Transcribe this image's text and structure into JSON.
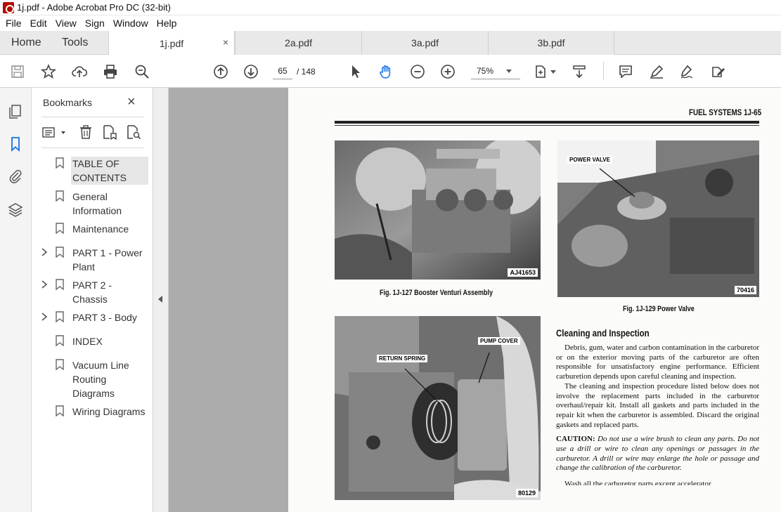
{
  "window": {
    "title": "1j.pdf - Adobe Acrobat Pro DC (32-bit)"
  },
  "menu": [
    "File",
    "Edit",
    "View",
    "Sign",
    "Window",
    "Help"
  ],
  "nav_tabs": {
    "home": "Home",
    "tools": "Tools"
  },
  "doc_tabs": [
    {
      "label": "1j.pdf",
      "active": true,
      "close": "×"
    },
    {
      "label": "2a.pdf"
    },
    {
      "label": "3a.pdf"
    },
    {
      "label": "3b.pdf"
    }
  ],
  "toolbar": {
    "page_current": "65",
    "page_total": "/ 148",
    "zoom": "75%"
  },
  "bookmarks": {
    "title": "Bookmarks",
    "close": "×",
    "items": [
      {
        "label": "TABLE OF CONTENTS",
        "expandable": false,
        "selected": true
      },
      {
        "label": "General Information",
        "expandable": false
      },
      {
        "label": "Maintenance",
        "expandable": false
      },
      {
        "label": "PART 1 - Power Plant",
        "expandable": true
      },
      {
        "label": "PART 2 - Chassis",
        "expandable": true
      },
      {
        "label": "PART 3 - Body",
        "expandable": true
      },
      {
        "label": "INDEX",
        "expandable": false
      },
      {
        "label": "Vacuum Line Routing Diagrams",
        "expandable": false
      },
      {
        "label": "Wiring Diagrams",
        "expandable": false
      }
    ]
  },
  "document": {
    "header": "FUEL SYSTEMS   1J-65",
    "figures": [
      {
        "code": "AJ41653",
        "caption": "Fig. 1J-127   Booster Venturi Assembly"
      },
      {
        "code": "70416",
        "caption": "Fig. 1J-129   Power Valve",
        "label": "POWER VALVE"
      },
      {
        "code": "80129",
        "label1": "RETURN SPRING",
        "label2": "PUMP COVER"
      }
    ],
    "section_heading": "Cleaning and Inspection",
    "paragraphs": [
      "Debris, gum, water and carbon contamination in the carburetor or on the exterior moving parts of the carburetor are often responsible for unsatisfactory engine performance. Efficient carburetion depends upon careful cleaning and inspection.",
      "The cleaning and inspection procedure listed below does not involve the replacement parts included in the carburetor overhaul/repair kit. Install all gaskets and parts included in the repair kit when the carburetor is assembled. Discard the original gaskets and replaced parts."
    ],
    "caution_label": "CAUTION:",
    "caution_text": "Do not use a wire brush to clean any parts. Do not use a drill or wire to clean any openings or passages in the carburetor. A drill or wire may enlarge the hole or passage and change the calibration of the carburetor.",
    "cut_line": "Wash all the carburetor parts except accelerator"
  }
}
